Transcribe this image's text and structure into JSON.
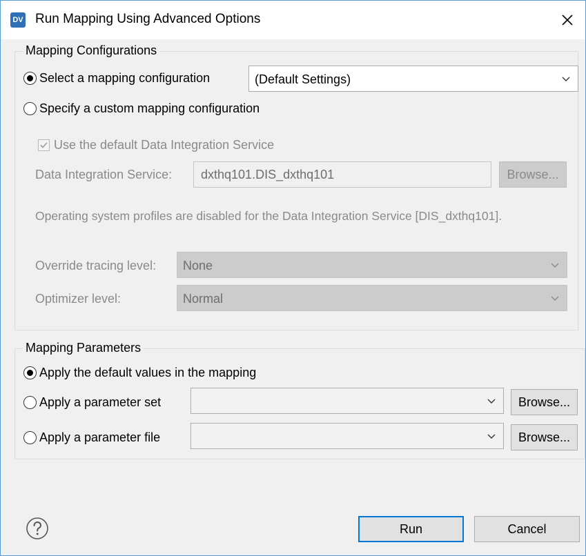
{
  "window": {
    "app_icon_text": "DV",
    "title": "Run Mapping Using Advanced Options"
  },
  "mapping_configurations": {
    "legend": "Mapping Configurations",
    "select_config_label": "Select a mapping configuration",
    "select_config_value": "(Default Settings)",
    "custom_config_label": "Specify a custom mapping configuration",
    "use_default_dis_label": "Use the default Data Integration Service",
    "dis_label": "Data Integration Service:",
    "dis_value": "dxthq101.DIS_dxthq101",
    "browse_label": "Browse...",
    "os_profiles_note": "Operating system profiles are disabled for the Data Integration Service [DIS_dxthq101].",
    "tracing_label": "Override tracing level:",
    "tracing_value": "None",
    "optimizer_label": "Optimizer level:",
    "optimizer_value": "Normal"
  },
  "mapping_parameters": {
    "legend": "Mapping Parameters",
    "apply_default_label": "Apply the default values in the mapping",
    "apply_param_set_label": "Apply a parameter set",
    "apply_param_file_label": "Apply a parameter file",
    "browse_label": "Browse..."
  },
  "footer": {
    "run_label": "Run",
    "cancel_label": "Cancel"
  },
  "colors": {
    "accent": "#0078d7",
    "window_border": "#5a9ad6",
    "app_icon": "#2f6fb5"
  }
}
